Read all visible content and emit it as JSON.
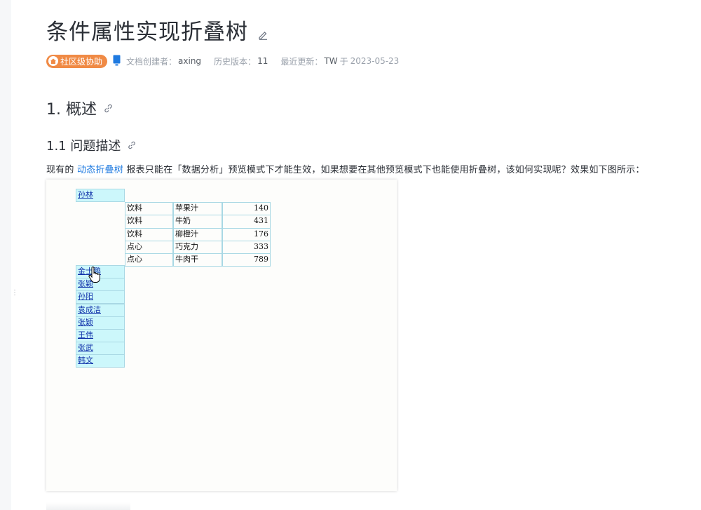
{
  "doc": {
    "title": "条件属性实现折叠树",
    "meta": {
      "badge_label": "社区级协助",
      "creator_label": "文档创建者：",
      "creator_value": "axing",
      "version_label": "历史版本：",
      "version_value": "11",
      "updated_label": "最近更新：",
      "updated_by": "TW",
      "updated_sep": "于",
      "updated_date": "2023-05-23"
    },
    "h1": "1. 概述",
    "h2": "1.1 问题描述",
    "para_before": "现有的",
    "para_link": "动态折叠树",
    "para_after": "报表只能在「数据分析」预览模式下才能生效，如果想要在其他预览模式下也能使用折叠树，该如何实现呢？效果如下图所示："
  },
  "preview": {
    "expanded_name": "孙林",
    "detail_rows": [
      {
        "category": "饮料",
        "product": "苹果汁",
        "qty": "140"
      },
      {
        "category": "饮料",
        "product": "牛奶",
        "qty": "431"
      },
      {
        "category": "饮料",
        "product": "柳橙汁",
        "qty": "176"
      },
      {
        "category": "点心",
        "product": "巧克力",
        "qty": "333"
      },
      {
        "category": "点心",
        "product": "牛肉干",
        "qty": "789"
      }
    ],
    "collapsed_names": [
      "金士鹏",
      "张颖",
      "孙阳",
      "袁成洁",
      "张颖",
      "王伟",
      "张武",
      "韩文"
    ]
  },
  "colors": {
    "badge": "#f08a45",
    "link": "#1f7ae0",
    "cell_border": "#a9d8e4",
    "name_cell_bg": "#ccf7fb"
  },
  "icons": {
    "edit": "pencil-icon",
    "badge": "home-icon",
    "device": "device-icon",
    "heading_link": "link-icon",
    "cursor": "hand-cursor-icon"
  }
}
